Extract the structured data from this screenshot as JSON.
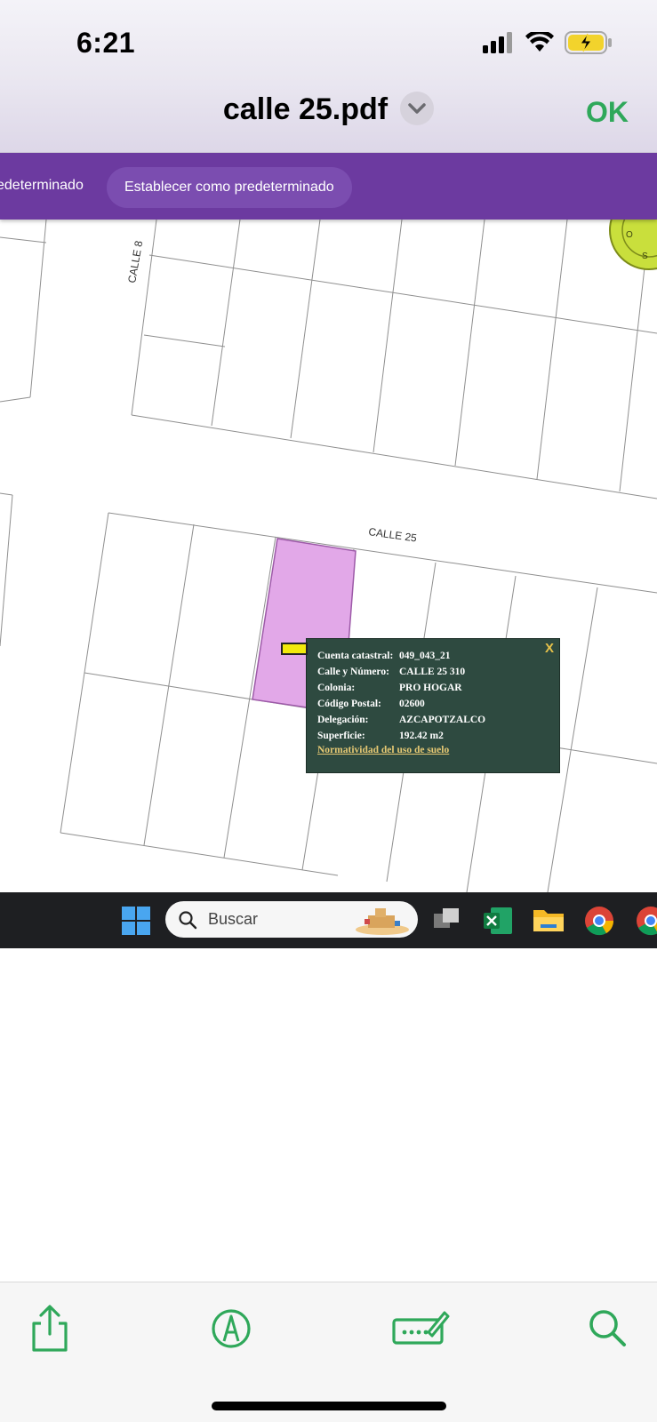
{
  "status_bar": {
    "time": "6:21",
    "icons": [
      "signal-icon",
      "wifi-icon",
      "battery-charging-icon"
    ]
  },
  "nav": {
    "title": "calle 25.pdf",
    "menu_icon": "chevron-down-icon",
    "done_label": "OK",
    "accent": "#2fa85a"
  },
  "pdf": {
    "banner": {
      "left_text": "edeterminado",
      "button_label": "Establecer como predeterminado",
      "color": "#6c3aa0"
    },
    "map": {
      "street_labels": [
        "CALLE 8",
        "CALLE 25"
      ],
      "highlight_color": "#e2a8e8",
      "popup": {
        "rows": [
          {
            "key": "Cuenta catastral:",
            "value": "049_043_21"
          },
          {
            "key": "Calle y Número:",
            "value": "CALLE 25 310"
          },
          {
            "key": "Colonia:",
            "value": "PRO HOGAR"
          },
          {
            "key": "Código Postal:",
            "value": "02600"
          },
          {
            "key": "Delegación:",
            "value": "AZCAPOTZALCO"
          },
          {
            "key": "Superficie:",
            "value": "192.42 m2"
          }
        ],
        "link": "Normatividad del uso de suelo",
        "close": "X"
      }
    },
    "taskbar": {
      "search_label": "Buscar",
      "icons": [
        "windows-start-icon",
        "task-view-icon",
        "excel-icon",
        "file-explorer-icon",
        "chrome-icon"
      ]
    }
  },
  "toolbar": {
    "icons": [
      "share-icon",
      "markup-icon",
      "signature-icon",
      "search-icon"
    ],
    "tint": "#2fa85a"
  }
}
